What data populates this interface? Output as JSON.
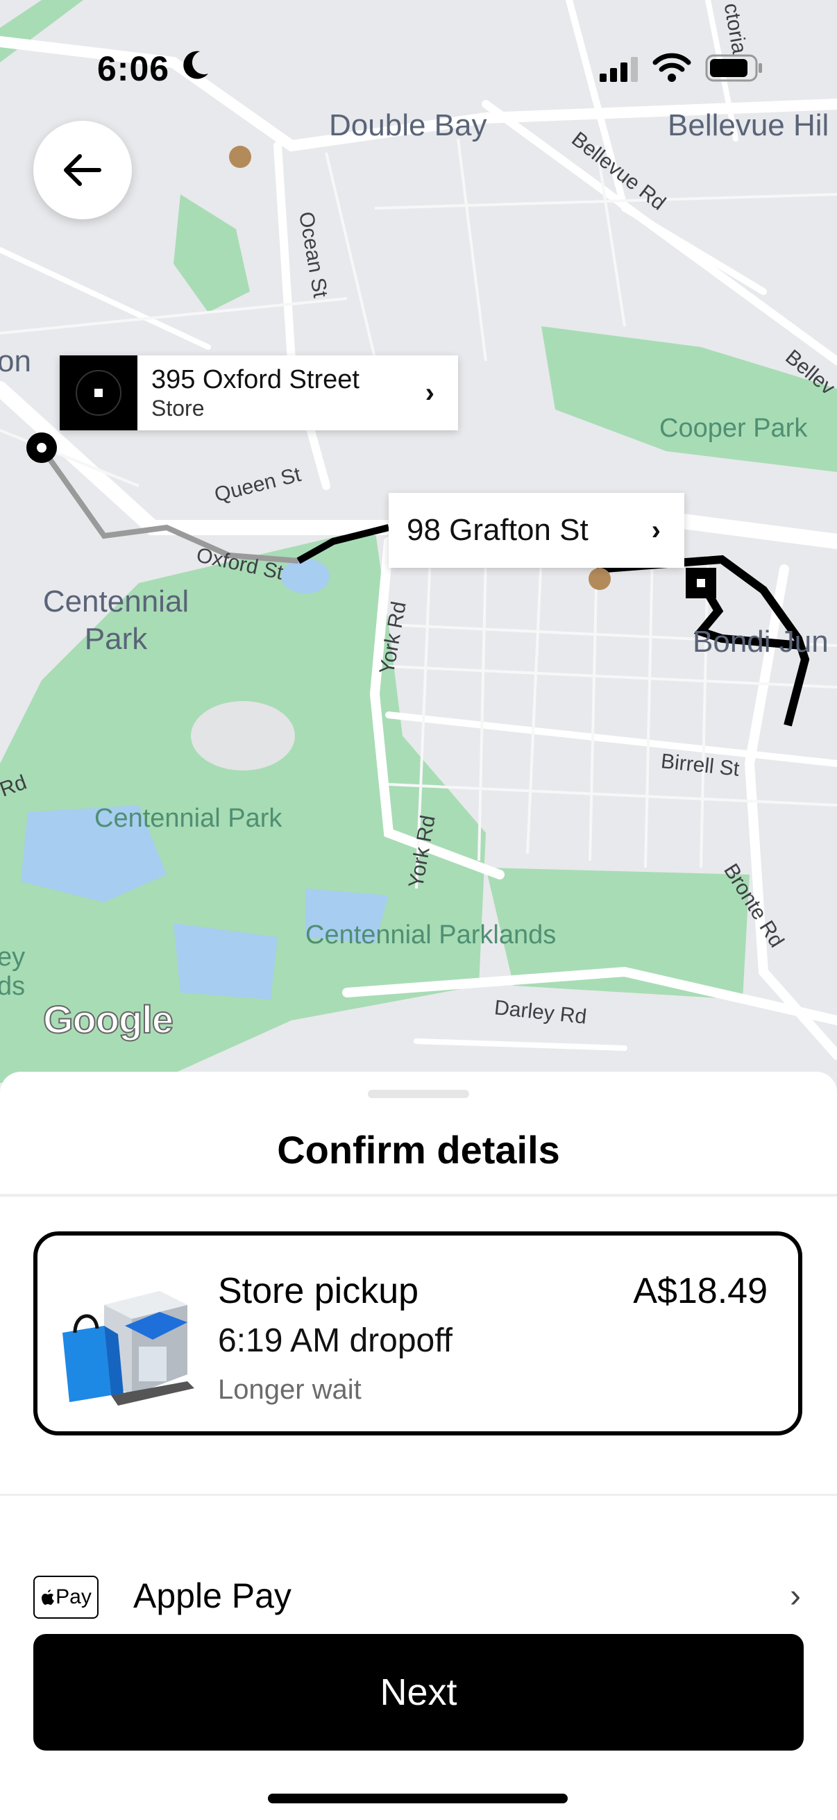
{
  "status_bar": {
    "time": "6:06"
  },
  "map": {
    "labels": {
      "double_bay": "Double Bay",
      "bellevue_hill": "Bellevue Hil",
      "bellevue_rd": "Bellevue Rd",
      "ocean_st": "Ocean St",
      "cooper_park": "Cooper Park",
      "queen_st": "Queen St",
      "oxford_st": "Oxford St",
      "centennial_park_area": "Centennial Park",
      "centennial_park_name": "Centennial Park",
      "centennial_parklands": "Centennial Parklands",
      "york_rd_1": "York Rd",
      "york_rd_2": "York Rd",
      "birrell_st": "Birrell St",
      "bronte_rd": "Bronte Rd",
      "darley_rd": "Darley Rd",
      "bondi_jun": "Bondi Jun",
      "victoria": "ctoria",
      "belle_edge": "Bellev",
      "on_edge": "on",
      "rd_edge": "Rd",
      "ey_ds": "ey ds"
    },
    "origin_pin": {
      "title": "395 Oxford Street",
      "subtitle": "Store",
      "chevron": "›"
    },
    "destination_pin": {
      "title": "98 Grafton St",
      "chevron": "›"
    },
    "attribution": "Google"
  },
  "sheet": {
    "title": "Confirm details",
    "option": {
      "title": "Store pickup",
      "price": "A$18.49",
      "time": "6:19 AM dropoff",
      "note": "Longer wait"
    },
    "payment": {
      "badge": "Pay",
      "label": "Apple Pay",
      "chevron": "›"
    },
    "next_label": "Next"
  },
  "colors": {
    "park": "#a8dcb5",
    "water": "#a7cdf0",
    "road": "#ffffff",
    "route": "#000000",
    "route_walked": "#9a9a9a"
  }
}
